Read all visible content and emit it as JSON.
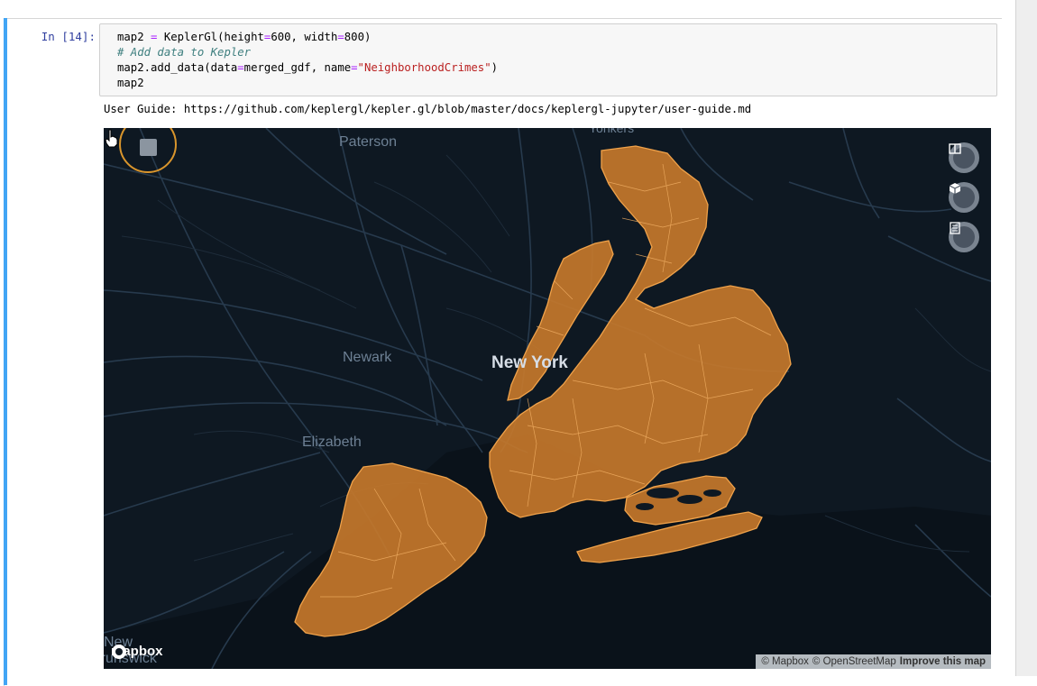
{
  "notebook": {
    "prompt": "In [14]:",
    "code_lines": [
      "map2 = KeplerGl(height=600, width=800)",
      "# Add data to Kepler",
      "map2.add_data(data=merged_gdf, name=\"NeighborhoodCrimes\")",
      "map2"
    ],
    "output_label": "User Guide: ",
    "output_link": "https://github.com/keplergl/kepler.gl/blob/master/docs/keplergl-jupyter/user-guide.md"
  },
  "map": {
    "places": {
      "paterson": "Paterson",
      "yonkers": "Yonkers",
      "newark": "Newark",
      "new_york": "New York",
      "elizabeth": "Elizabeth",
      "new_brunswick_1": "New",
      "new_brunswick_2": "Brunswick"
    },
    "controls": [
      "split-map-icon",
      "3d-view-icon",
      "legend-icon"
    ],
    "logo": "mapbox",
    "attribution": {
      "mapbox": "© Mapbox",
      "osm": "© OpenStreetMap",
      "improve": "Improve this map"
    },
    "colors": {
      "background": "#0e1822",
      "water": "#0b141c",
      "roads": "#26384a",
      "boundary_fill": "#c97a2b",
      "boundary_stroke": "#f0a24a",
      "highlight": "#d9952c"
    }
  }
}
